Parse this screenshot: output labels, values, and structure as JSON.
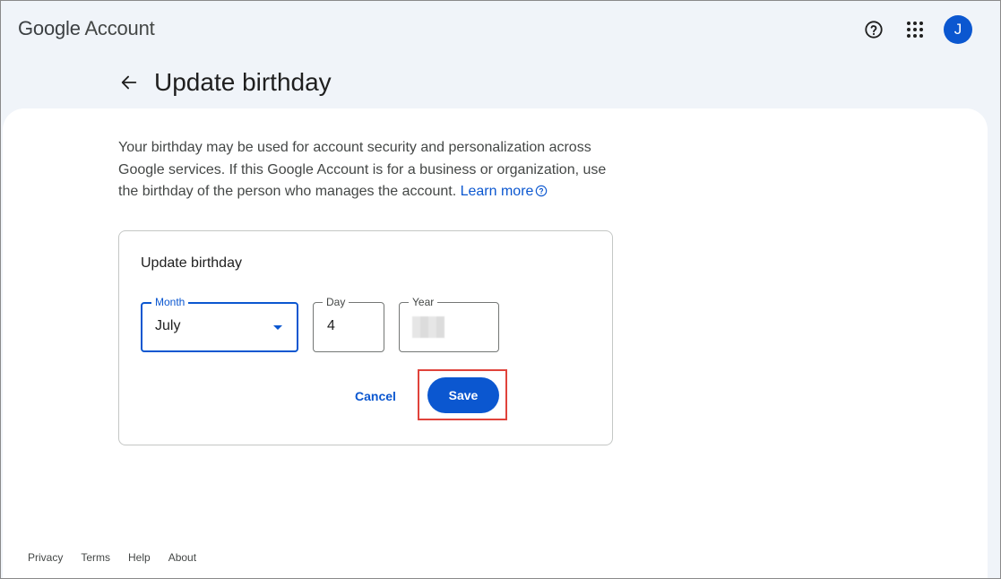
{
  "header": {
    "logo_google": "Google",
    "logo_account": "Account",
    "avatar_initial": "J",
    "icons": [
      "help-icon",
      "apps-icon"
    ]
  },
  "page": {
    "title": "Update birthday",
    "description": "Your birthday may be used for account security and personalization across Google services. If this Google Account is for a business or organization, use the birthday of the person who manages the account.",
    "learn_more": "Learn more"
  },
  "form": {
    "card_title": "Update birthday",
    "month_label": "Month",
    "month_value": "July",
    "day_label": "Day",
    "day_value": "4",
    "year_label": "Year",
    "cancel_label": "Cancel",
    "save_label": "Save"
  },
  "footer": {
    "links": [
      "Privacy",
      "Terms",
      "Help",
      "About"
    ]
  },
  "colors": {
    "accent": "#0b57d0",
    "highlight": "#e0433b",
    "background": "#f0f4f9"
  }
}
